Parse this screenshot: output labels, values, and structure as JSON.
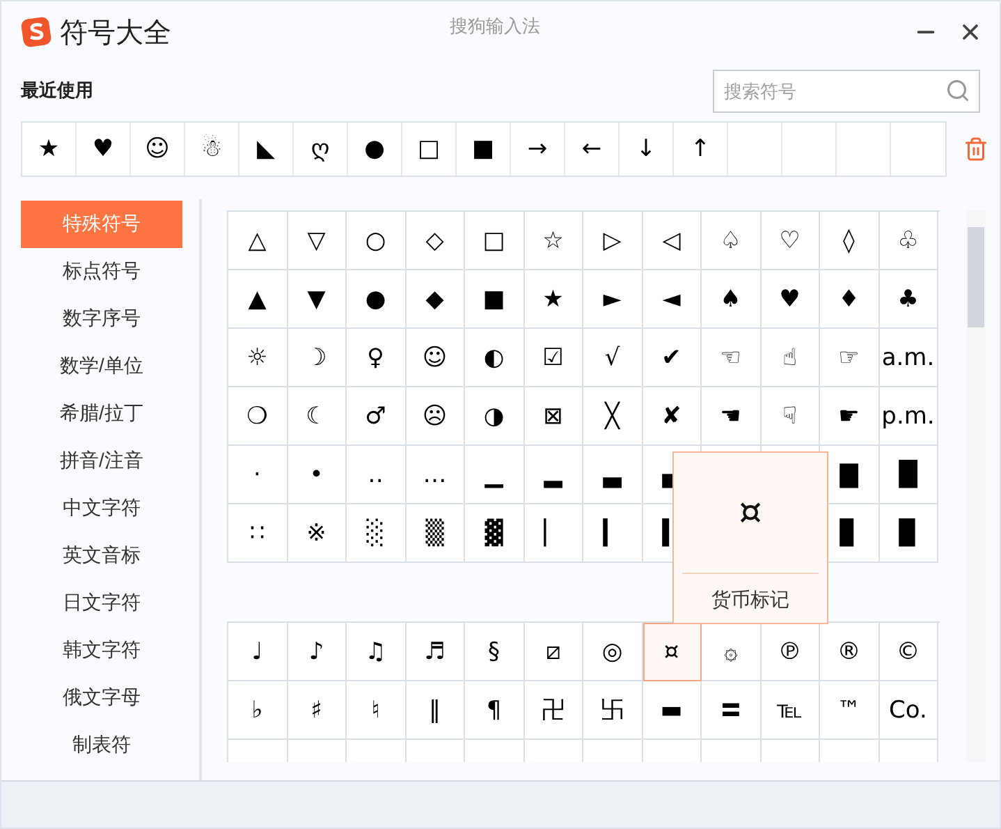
{
  "window": {
    "title": "符号大全",
    "app_name": "搜狗输入法"
  },
  "recent": {
    "label": "最近使用",
    "symbols": [
      "★",
      "♥",
      "☺",
      "☃",
      "◣",
      "ღ",
      "●",
      "□",
      "■",
      "→",
      "←",
      "↓",
      "↑"
    ]
  },
  "search": {
    "placeholder": "搜索符号"
  },
  "categories": [
    {
      "label": "特殊符号",
      "selected": true
    },
    {
      "label": "标点符号",
      "selected": false
    },
    {
      "label": "数字序号",
      "selected": false
    },
    {
      "label": "数学/单位",
      "selected": false
    },
    {
      "label": "希腊/拉丁",
      "selected": false
    },
    {
      "label": "拼音/注音",
      "selected": false
    },
    {
      "label": "中文字符",
      "selected": false
    },
    {
      "label": "英文音标",
      "selected": false
    },
    {
      "label": "日文字符",
      "selected": false
    },
    {
      "label": "韩文字符",
      "selected": false
    },
    {
      "label": "俄文字母",
      "selected": false
    },
    {
      "label": "制表符",
      "selected": false
    }
  ],
  "symbol_groups": [
    {
      "rows": [
        [
          {
            "symbol": "△",
            "selected": false
          },
          {
            "symbol": "▽",
            "selected": false
          },
          {
            "symbol": "○",
            "selected": false
          },
          {
            "symbol": "◇",
            "selected": false
          },
          {
            "symbol": "□",
            "selected": false
          },
          {
            "symbol": "☆",
            "selected": false
          },
          {
            "symbol": "▷",
            "selected": false
          },
          {
            "symbol": "◁",
            "selected": false
          },
          {
            "symbol": "♤",
            "selected": false
          },
          {
            "symbol": "♡",
            "selected": false
          },
          {
            "symbol": "◊",
            "selected": false
          },
          {
            "symbol": "♧",
            "selected": false
          }
        ],
        [
          {
            "symbol": "▲",
            "selected": false
          },
          {
            "symbol": "▼",
            "selected": false
          },
          {
            "symbol": "●",
            "selected": false
          },
          {
            "symbol": "◆",
            "selected": false
          },
          {
            "symbol": "■",
            "selected": false
          },
          {
            "symbol": "★",
            "selected": false
          },
          {
            "symbol": "►",
            "selected": false
          },
          {
            "symbol": "◄",
            "selected": false
          },
          {
            "symbol": "♠",
            "selected": false
          },
          {
            "symbol": "♥",
            "selected": false
          },
          {
            "symbol": "♦",
            "selected": false
          },
          {
            "symbol": "♣",
            "selected": false
          }
        ],
        [
          {
            "symbol": "☼",
            "selected": false
          },
          {
            "symbol": "☽",
            "selected": false
          },
          {
            "symbol": "♀",
            "selected": false
          },
          {
            "symbol": "☺",
            "selected": false
          },
          {
            "symbol": "◐",
            "selected": false
          },
          {
            "symbol": "☑",
            "selected": false
          },
          {
            "symbol": "√",
            "selected": false
          },
          {
            "symbol": "✔",
            "selected": false
          },
          {
            "symbol": "☜",
            "selected": false
          },
          {
            "symbol": "☝",
            "selected": false
          },
          {
            "symbol": "☞",
            "selected": false
          },
          {
            "symbol": "a.m.",
            "selected": false
          }
        ],
        [
          {
            "symbol": "❍",
            "selected": false
          },
          {
            "symbol": "☾",
            "selected": false
          },
          {
            "symbol": "♂",
            "selected": false
          },
          {
            "symbol": "☹",
            "selected": false
          },
          {
            "symbol": "◑",
            "selected": false
          },
          {
            "symbol": "⊠",
            "selected": false
          },
          {
            "symbol": "╳",
            "selected": false
          },
          {
            "symbol": "✘",
            "selected": false
          },
          {
            "symbol": "☚",
            "selected": false
          },
          {
            "symbol": "☟",
            "selected": false
          },
          {
            "symbol": "☛",
            "selected": false
          },
          {
            "symbol": "p.m.",
            "selected": false
          }
        ],
        [
          {
            "symbol": "·",
            "selected": false
          },
          {
            "symbol": "•",
            "selected": false
          },
          {
            "symbol": "‥",
            "selected": false
          },
          {
            "symbol": "…",
            "selected": false
          },
          {
            "symbol": "▁",
            "selected": false
          },
          {
            "symbol": "▂",
            "selected": false
          },
          {
            "symbol": "▃",
            "selected": false
          },
          {
            "symbol": "▄",
            "selected": false
          },
          null,
          null,
          {
            "symbol": "▇",
            "selected": false
          },
          {
            "symbol": "█",
            "selected": false
          }
        ],
        [
          {
            "symbol": "∷",
            "selected": false
          },
          {
            "symbol": "※",
            "selected": false
          },
          {
            "symbol": "░",
            "selected": false
          },
          {
            "symbol": "▒",
            "selected": false
          },
          {
            "symbol": "▓",
            "selected": false
          },
          {
            "symbol": "▏",
            "selected": false
          },
          {
            "symbol": "▎",
            "selected": false
          },
          {
            "symbol": "▍",
            "selected": false
          },
          null,
          null,
          {
            "symbol": "▊",
            "selected": false
          },
          {
            "symbol": "▉",
            "selected": false
          }
        ]
      ]
    },
    {
      "rows": [
        [
          {
            "symbol": "♩",
            "selected": false
          },
          {
            "symbol": "♪",
            "selected": false
          },
          {
            "symbol": "♫",
            "selected": false
          },
          {
            "symbol": "♬",
            "selected": false
          },
          {
            "symbol": "§",
            "selected": false
          },
          {
            "symbol": "⧄",
            "selected": false
          },
          {
            "symbol": "◎",
            "selected": false
          },
          {
            "symbol": "¤",
            "selected": true
          },
          {
            "symbol": "۞",
            "selected": false
          },
          {
            "symbol": "℗",
            "selected": false
          },
          {
            "symbol": "®",
            "selected": false
          },
          {
            "symbol": "©",
            "selected": false
          }
        ],
        [
          {
            "symbol": "♭",
            "selected": false
          },
          {
            "symbol": "♯",
            "selected": false
          },
          {
            "symbol": "♮",
            "selected": false
          },
          {
            "symbol": "‖",
            "selected": false
          },
          {
            "symbol": "¶",
            "selected": false
          },
          {
            "symbol": "卍",
            "selected": false
          },
          {
            "symbol": "卐",
            "selected": false
          },
          {
            "symbol": "▬",
            "selected": false
          },
          {
            "symbol": "〓",
            "selected": false
          },
          {
            "symbol": "℡",
            "selected": false
          },
          {
            "symbol": "™",
            "selected": false
          },
          {
            "symbol": "Co.",
            "selected": false
          }
        ]
      ]
    }
  ],
  "preview": {
    "symbol": "¤",
    "label": "货币标记"
  }
}
